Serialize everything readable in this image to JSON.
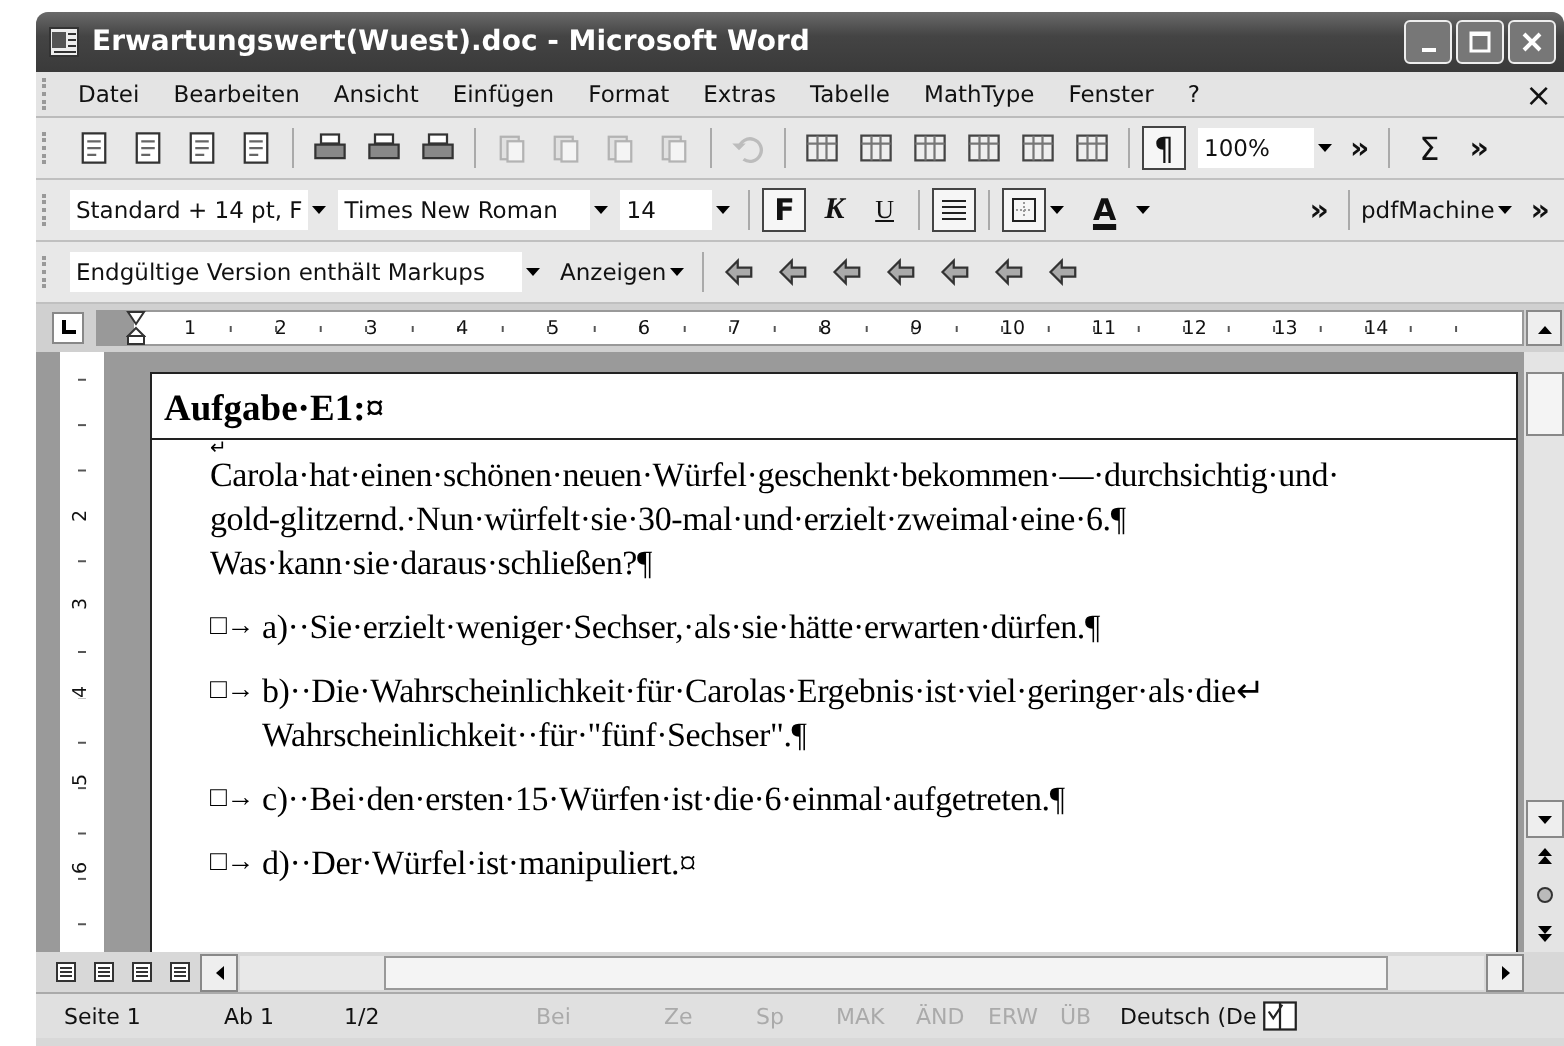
{
  "window": {
    "title": "Erwartungswert(Wuest).doc - Microsoft Word",
    "close_document": "×"
  },
  "menu": [
    {
      "label": "Datei"
    },
    {
      "label": "Bearbeiten"
    },
    {
      "label": "Ansicht"
    },
    {
      "label": "Einfügen"
    },
    {
      "label": "Format"
    },
    {
      "label": "Extras"
    },
    {
      "label": "Tabelle"
    },
    {
      "label": "MathType"
    },
    {
      "label": "Fenster"
    },
    {
      "label": "?"
    }
  ],
  "standard_toolbar": {
    "marks": {
      "label": "¶",
      "on": true
    },
    "zoom": "100%",
    "more": "»",
    "sum": "Σ",
    "more_2": "»"
  },
  "formatting_toolbar": {
    "style": "Standard + 14 pt, F",
    "font": "Times New Roman",
    "size": "14",
    "buttons": [
      {
        "label": "F",
        "kind": "bold",
        "on": true
      },
      {
        "label": "K",
        "kind": "italic",
        "on": false
      },
      {
        "label": "U",
        "kind": "underline",
        "on": false
      }
    ],
    "align_left_on": true,
    "border_on": true,
    "color_letter": "A",
    "more": "»",
    "pdf": "pdfMachine",
    "more_2": "»"
  },
  "review_toolbar": {
    "view": "Endgültige Version enthält Markups",
    "show": "Anzeigen"
  },
  "ruler": {
    "numbers": [
      "1",
      "2",
      "3",
      "4",
      "5",
      "6",
      "7",
      "8",
      "9",
      "10",
      "11",
      "12",
      "13",
      "14"
    ],
    "vertical_numbers": [
      "2",
      "3",
      "4",
      "5",
      "6"
    ]
  },
  "document": {
    "heading": "Aufgabe·E1:¤",
    "break_mark": "↵",
    "intro": [
      "Carola·hat·einen·schönen·neuen·Würfel·geschenkt·bekommen·—·durchsichtig·und·",
      "gold-glitzernd.·Nun·würfelt·sie·30-mal·und·erzielt·zweimal·eine·6.¶",
      "Was·kann·sie·daraus·schließen?¶"
    ],
    "options": [
      {
        "marker": "□→",
        "lines": [
          "a)··Sie·erzielt·weniger·Sechser,·als·sie·hätte·erwarten·dürfen.¶"
        ]
      },
      {
        "marker": "□→",
        "lines": [
          "b)··Die·Wahrscheinlichkeit·für·Carolas·Ergebnis·ist·viel·geringer·als·die↵",
          "Wahrscheinlichkeit··für·\"fünf·Sechser\".¶"
        ]
      },
      {
        "marker": "□→",
        "lines": [
          "c)··Bei·den·ersten·15·Würfen·ist·die·6·einmal·aufgetreten.¶"
        ]
      },
      {
        "marker": "□→",
        "lines": [
          "d)··Der·Würfel·ist·manipuliert.¤"
        ]
      }
    ]
  },
  "status_bar": [
    {
      "text": "Seite 1",
      "disabled": false
    },
    {
      "text": "Ab 1",
      "disabled": false
    },
    {
      "text": "1/2",
      "disabled": false
    },
    {
      "text": "Bei",
      "disabled": true
    },
    {
      "text": "Ze",
      "disabled": true
    },
    {
      "text": "Sp",
      "disabled": true
    },
    {
      "text": "MAK",
      "disabled": true
    },
    {
      "text": "ÄND",
      "disabled": true
    },
    {
      "text": "ERW",
      "disabled": true
    },
    {
      "text": "ÜB",
      "disabled": true
    },
    {
      "text": "Deutsch (De",
      "disabled": false
    }
  ]
}
